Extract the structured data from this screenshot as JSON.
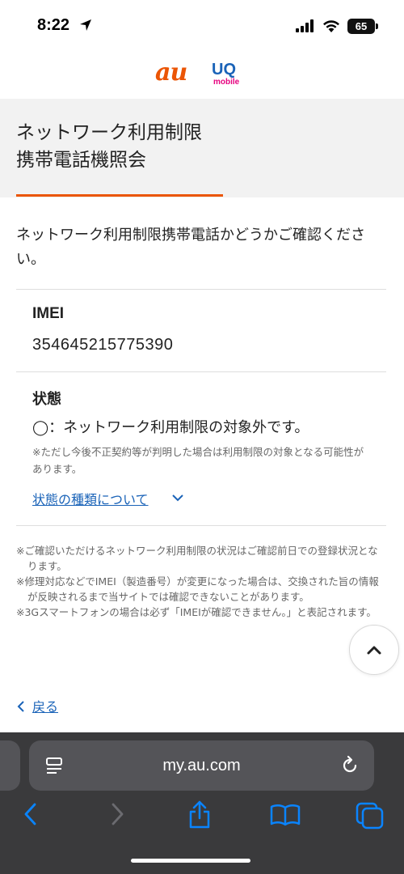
{
  "status_bar": {
    "time": "8:22",
    "battery": "65"
  },
  "logos": {
    "au": "au",
    "uq": "UQ",
    "uq_sub": "mobile"
  },
  "page": {
    "title_line1": "ネットワーク利用制限",
    "title_line2": "携帯電話機照会",
    "intro": "ネットワーク利用制限携帯電話かどうかご確認ください。"
  },
  "imei": {
    "label": "IMEI",
    "value": "354645215775390"
  },
  "status": {
    "label": "状態",
    "value": "◯：ネットワーク利用制限の対象外です。",
    "note": "※ただし今後不正契約等が判明した場合は利用制限の対象となる可能性があります。",
    "types_link": "状態の種類について"
  },
  "notes": [
    "※ご確認いただけるネットワーク利用制限の状況はご確認前日での登録状況となります。",
    "※修理対応などでIMEI（製造番号）が変更になった場合は、交換された旨の情報が反映されるまで当サイトでは確認できないことがあります。",
    "※3Gスマートフォンの場合は必ず「IMEIが確認できません。」と表記されます。"
  ],
  "nav": {
    "back": "戻る"
  },
  "browser": {
    "url": "my.au.com"
  },
  "colors": {
    "accent": "#eb5505",
    "link": "#1a63b8",
    "toolbar_icon": "#0a84ff"
  }
}
